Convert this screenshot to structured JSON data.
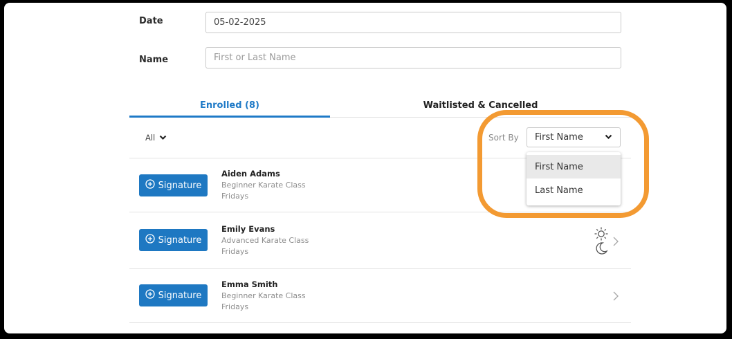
{
  "form": {
    "date_label": "Date",
    "date_value": "05-02-2025",
    "name_label": "Name",
    "name_placeholder": "First or Last Name"
  },
  "tabs": [
    {
      "label": "Enrolled (8)",
      "active": true
    },
    {
      "label": "Waitlisted & Cancelled",
      "active": false
    }
  ],
  "filter": {
    "label": "All"
  },
  "sort": {
    "label": "Sort By",
    "selected": "First Name",
    "options": [
      "First Name",
      "Last Name"
    ]
  },
  "students": [
    {
      "name": "Aiden Adams",
      "class": "Beginner Karate Class",
      "day": "Fridays",
      "button": "Signature"
    },
    {
      "name": "Emily Evans",
      "class": "Advanced Karate Class",
      "day": "Fridays",
      "button": "Signature"
    },
    {
      "name": "Emma Smith",
      "class": "Beginner Karate Class",
      "day": "Fridays",
      "button": "Signature"
    }
  ],
  "colors": {
    "accent": "#1e78c2",
    "tab_active": "#1f7ac7",
    "highlight": "#f39a32"
  },
  "icons": {
    "signature_button": "plus-circle-icon",
    "row_navigation": "chevron-right-icon",
    "theme_light": "sun-icon",
    "theme_dark": "moon-icon"
  }
}
